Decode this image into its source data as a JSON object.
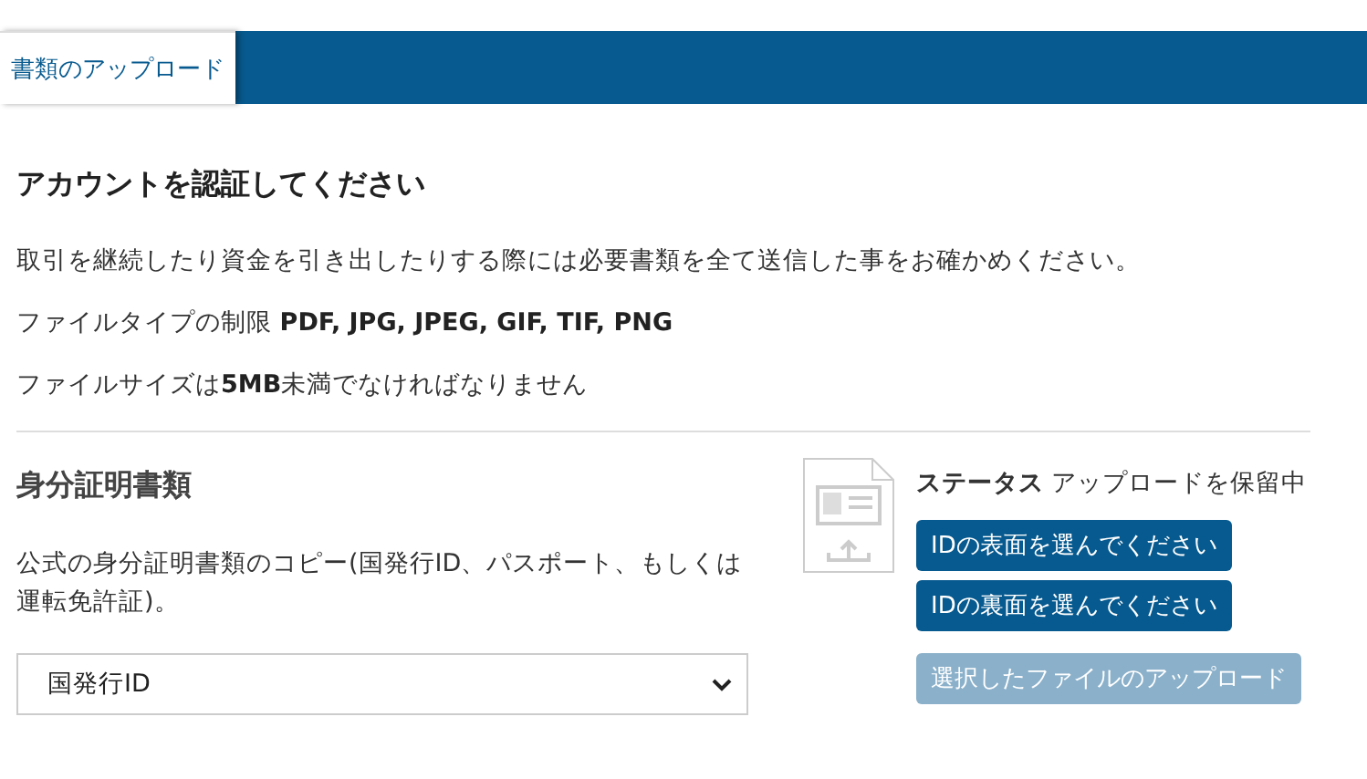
{
  "tabs": [
    {
      "label": "書類のアップロード",
      "selected": true
    }
  ],
  "heading": "アカウントを認証してください",
  "paragraphs": [
    "取引を継続したり資金を引き出したりする際には必要書類を全て送信した事をお確かめください。",
    "ファイルタイプの制限 **PDF, JPG, JPEG, GIF, TIF, PNG**",
    "ファイルサイズは**5MB**未満でなければなりません"
  ],
  "section": {
    "title": "身分証明書類",
    "description": "公式の身分証明書類のコピー(国発行ID、パスポート、もしくは運転免許証)。",
    "select": {
      "value": "国発行ID"
    },
    "status": {
      "label": "ステータス",
      "value": "アップロードを保留中"
    },
    "buttons": [
      {
        "label": "IDの表面を選んでください",
        "disabled": false
      },
      {
        "label": "IDの裏面を選んでください",
        "disabled": false
      },
      {
        "label": "選択したファイルのアップロード",
        "disabled": true
      }
    ]
  }
}
